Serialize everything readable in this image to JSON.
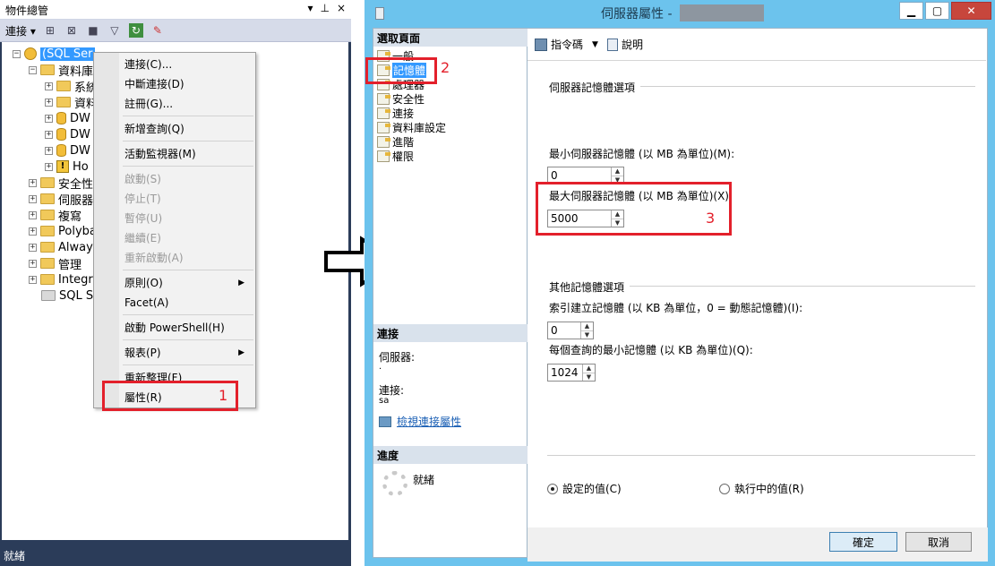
{
  "object_explorer": {
    "title": "物件總管",
    "pin_icon": "pin-icon",
    "close_label": "×",
    "toolbar": {
      "connect_label": "連接"
    },
    "tree": {
      "server_label": "(SQL Ser",
      "databases_label": "資料庫",
      "db_children": [
        "系統",
        "資料",
        "DW",
        "DW",
        "DW",
        "Ho"
      ],
      "top_level": [
        "安全性",
        "伺服器",
        "複寫",
        "Polyba",
        "Always",
        "管理",
        "Integra",
        "SQL Se"
      ]
    },
    "status": "就緒"
  },
  "context_menu": {
    "items": [
      {
        "label": "連接(C)...",
        "disabled": false
      },
      {
        "label": "中斷連接(D)",
        "disabled": false
      },
      {
        "label": "註冊(G)...",
        "disabled": false
      },
      {
        "label": "新增查詢(Q)",
        "disabled": false
      },
      {
        "label": "活動監視器(M)",
        "disabled": false
      },
      {
        "label": "啟動(S)",
        "disabled": true
      },
      {
        "label": "停止(T)",
        "disabled": true
      },
      {
        "label": "暫停(U)",
        "disabled": true
      },
      {
        "label": "繼續(E)",
        "disabled": true
      },
      {
        "label": "重新啟動(A)",
        "disabled": true
      },
      {
        "label": "原則(O)",
        "disabled": false
      },
      {
        "label": "Facet(A)",
        "disabled": false
      },
      {
        "label": "啟動 PowerShell(H)",
        "disabled": false
      },
      {
        "label": "報表(P)",
        "disabled": false
      },
      {
        "label": "重新整理(F)",
        "disabled": false
      },
      {
        "label": "屬性(R)",
        "disabled": false
      }
    ]
  },
  "dialog": {
    "title": "伺服器屬性 -",
    "select_page_header": "選取頁面",
    "pages": [
      "一般",
      "記憶體",
      "處理器",
      "安全性",
      "連接",
      "資料庫設定",
      "進階",
      "權限"
    ],
    "selected_page": "記憶體",
    "connection_header": "連接",
    "server_label": "伺服器:",
    "server_value": ".",
    "connection_label": "連接:",
    "connection_value": "sa",
    "view_connection_link": "檢視連接屬性",
    "progress_header": "進度",
    "progress_status": "就緒",
    "toolbar": {
      "script_label": "指令碼",
      "help_label": "說明"
    },
    "server_memory_group": "伺服器記憶體選項",
    "min_memory_label": "最小伺服器記憶體 (以 MB 為單位)(M):",
    "min_memory_value": "0",
    "max_memory_label": "最大伺服器記憶體 (以 MB 為單位)(X):",
    "max_memory_value": "5000",
    "other_memory_group": "其他記憶體選項",
    "index_memory_label": "索引建立記憶體 (以 KB 為單位，0 = 動態記憶體)(I):",
    "index_memory_value": "0",
    "min_query_memory_label": "每個查詢的最小記憶體 (以 KB 為單位)(Q):",
    "min_query_memory_value": "1024",
    "radio_configured": "設定的值(C)",
    "radio_running": "執行中的值(R)",
    "ok_label": "確定",
    "cancel_label": "取消"
  },
  "annotations": [
    "1",
    "2",
    "3"
  ],
  "colors": {
    "annotation_red": "#e3202b",
    "selection_blue": "#3399ff",
    "dialog_frame": "#6cc3ed",
    "ide_dark": "#2b3c59"
  }
}
